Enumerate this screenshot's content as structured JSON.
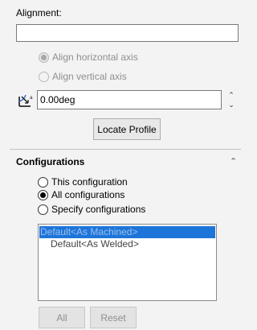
{
  "alignment": {
    "label": "Alignment:",
    "input_value": "",
    "options": [
      {
        "label": "Align horizontal axis",
        "checked": true,
        "enabled": false
      },
      {
        "label": "Align vertical axis",
        "checked": false,
        "enabled": false
      }
    ],
    "angle_icon": "angle-icon",
    "angle_value": "0.00deg",
    "locate_button": "Locate Profile"
  },
  "configurations": {
    "title": "Configurations",
    "options": [
      {
        "label": "This configuration",
        "checked": false
      },
      {
        "label": "All configurations",
        "checked": true
      },
      {
        "label": "Specify configurations",
        "checked": false
      }
    ],
    "list": [
      {
        "label": "Default<As Machined>",
        "selected": true
      },
      {
        "label": "Default<As Welded>",
        "selected": false
      }
    ],
    "buttons": {
      "all": "All",
      "reset": "Reset"
    }
  },
  "icons": {
    "collapse": "chevron-up-icon",
    "spin_up": "spin-up-icon",
    "spin_down": "spin-down-icon"
  }
}
